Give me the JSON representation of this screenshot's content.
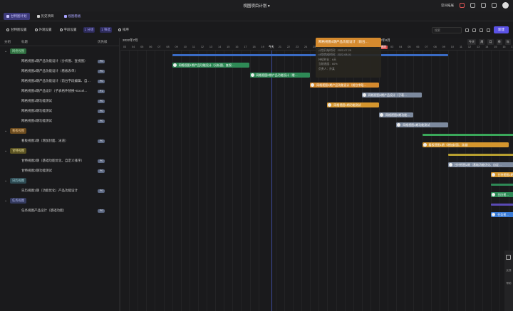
{
  "app": {
    "title": "视图项目计划 ▾"
  },
  "top_right": {
    "label": "空间拓展"
  },
  "tabs": [
    {
      "label": "甘特图计划",
      "active": true
    },
    {
      "label": "历史项目",
      "active": false
    },
    {
      "label": "视图看板",
      "active": false
    }
  ],
  "toolbar": {
    "items": [
      {
        "label": "甘特图设置",
        "pill": false
      },
      {
        "label": "外观设置",
        "pill": false
      },
      {
        "label": "字段设置",
        "pill": false
      },
      {
        "label": "1 分组",
        "pill": true
      },
      {
        "label": "1 筛选",
        "pill": true
      },
      {
        "label": "排序",
        "pill": false
      }
    ],
    "search_placeholder": "搜索",
    "new_button": "新建"
  },
  "left_header": {
    "col_group": "分组",
    "col_title": "标题",
    "col_priority": "优先级"
  },
  "groups": [
    {
      "tag": "网络视图",
      "color": "#2e6a3e",
      "text_color": "#9fe0b0"
    },
    {
      "tag": "看板视图",
      "color": "#6a4a1e",
      "text_color": "#f0c890"
    },
    {
      "tag": "甘特视图",
      "color": "#5a5222",
      "text_color": "#e8dc98"
    },
    {
      "tag": "日历视图",
      "color": "#2e4a52",
      "text_color": "#a8d8e0"
    },
    {
      "tag": "任务视图",
      "color": "#343a5e",
      "text_color": "#b0b8f0"
    }
  ],
  "rows": [
    {
      "group": 0
    },
    {
      "title": "网格视图1期产品功能设计（分析图、查视图）",
      "priority": "P0"
    },
    {
      "title": "网格视图2期产品功能设计（看板表单）",
      "priority": "P0"
    },
    {
      "title": "网格视图3期产品功能设计（前台字段编辑、自…",
      "priority": "P0"
    },
    {
      "title": "网格视图4期产品设计（子表格件替换+Excel…",
      "priority": "P1"
    },
    {
      "title": "网格视图1期功能测试",
      "priority": "P0"
    },
    {
      "title": "网格视图3期功能测试",
      "priority": "P0"
    },
    {
      "title": "网格视图4期功能测试",
      "priority": "P0"
    },
    {
      "group": 1
    },
    {
      "title": "看板视图1期（增加封面、泳道）",
      "priority": "P0"
    },
    {
      "group": 2
    },
    {
      "title": "甘特视图2期（基础功能优化、自定义排序）",
      "priority": "P0"
    },
    {
      "title": "甘特视图2期功能测试",
      "priority": "P0"
    },
    {
      "group": 3
    },
    {
      "title": "日历视图1期（功能优化）产品功能设计",
      "priority": "P0"
    },
    {
      "group": 4
    },
    {
      "title": "任务视图产品设计（基础功能）",
      "priority": "P0"
    }
  ],
  "timeline": {
    "months": [
      {
        "label": "2022年7月"
      },
      {
        "label": "2022年8月"
      }
    ],
    "days": [
      "03",
      "04",
      "05",
      "06",
      "07",
      "08",
      "09",
      "10",
      "11",
      "12",
      "13",
      "14",
      "15",
      "16",
      "17",
      "18",
      "19",
      "今天",
      "21",
      "22",
      "23",
      "24",
      "25",
      "26",
      "27",
      "28",
      "29",
      "30",
      "31",
      "01",
      "02",
      "03",
      "04",
      "05",
      "06",
      "07",
      "08",
      "09",
      "10",
      "11",
      "12",
      "13",
      "14",
      "15",
      "16",
      "17",
      "18",
      "19",
      "20"
    ],
    "today_label": "今天",
    "highlight_day": "建期",
    "controls": [
      "今天",
      "周",
      "月",
      "季",
      "年"
    ]
  },
  "bars": [
    {
      "row": 1,
      "label": "网格视图1期产品功能设计（分析图、查视…",
      "color": "#2e8a56",
      "start": 6,
      "len": 9
    },
    {
      "row": 2,
      "label": "网格视图2期产品功能设计（看…",
      "color": "#2e8a56",
      "start": 15,
      "len": 7
    },
    {
      "row": 3,
      "label": "网格视图3期产品功能设计（前台字段…",
      "color": "#d58a2e",
      "start": 22,
      "len": 8
    },
    {
      "row": 4,
      "label": "网格视图4期产品设计（子表…",
      "color": "#7d8a9e",
      "start": 28,
      "len": 7
    },
    {
      "row": 5,
      "label": "网格视图1期功能测试",
      "color": "#d5962e",
      "start": 24,
      "len": 6
    },
    {
      "row": 6,
      "label": "网格视图3期功能…",
      "color": "#7d8a9e",
      "start": 30,
      "len": 4
    },
    {
      "row": 7,
      "label": "网格视图4期功能测试",
      "color": "#7d8a9e",
      "start": 32,
      "len": 6
    },
    {
      "row": 9,
      "label": "看板视图1期（增加封面、泳道）",
      "color": "#d5962e",
      "start": 35,
      "len": 10
    },
    {
      "row": 11,
      "label": "甘特视图2期（基础功能优化、自定…",
      "color": "#7d8a9e",
      "start": 38,
      "len": 8
    },
    {
      "row": 12,
      "label": "甘特视图2期功…",
      "color": "#d5962e",
      "start": 43,
      "len": 4
    },
    {
      "row": 14,
      "label": "日历视…",
      "color": "#2e8a56",
      "start": 43,
      "len": 3
    },
    {
      "row": 16,
      "label": "任务视…",
      "color": "#3a7bd5",
      "start": 43,
      "len": 3
    }
  ],
  "summary_bars": [
    {
      "row": 0,
      "color": "#3a6bc5",
      "start": 6,
      "len": 32
    },
    {
      "row": 8,
      "color": "#3aa85a",
      "start": 35,
      "len": 12
    },
    {
      "row": 10,
      "color": "#b8a030",
      "start": 38,
      "len": 9
    },
    {
      "row": 13,
      "color": "#2e8a56",
      "start": 43,
      "len": 3
    },
    {
      "row": 15,
      "color": "#5a4ab5",
      "start": 43,
      "len": 3
    }
  ],
  "tooltip": {
    "title": "网格视图4期产品功能设计（前台…",
    "lines": [
      "计划开始时间：2022-07-25",
      "计划完成时间：2022-08-01",
      "持续时长：6天",
      "当前进度：60%",
      "负责人：孙某"
    ]
  },
  "side_dock": {
    "labels": [
      "反馈",
      "帮助"
    ]
  }
}
